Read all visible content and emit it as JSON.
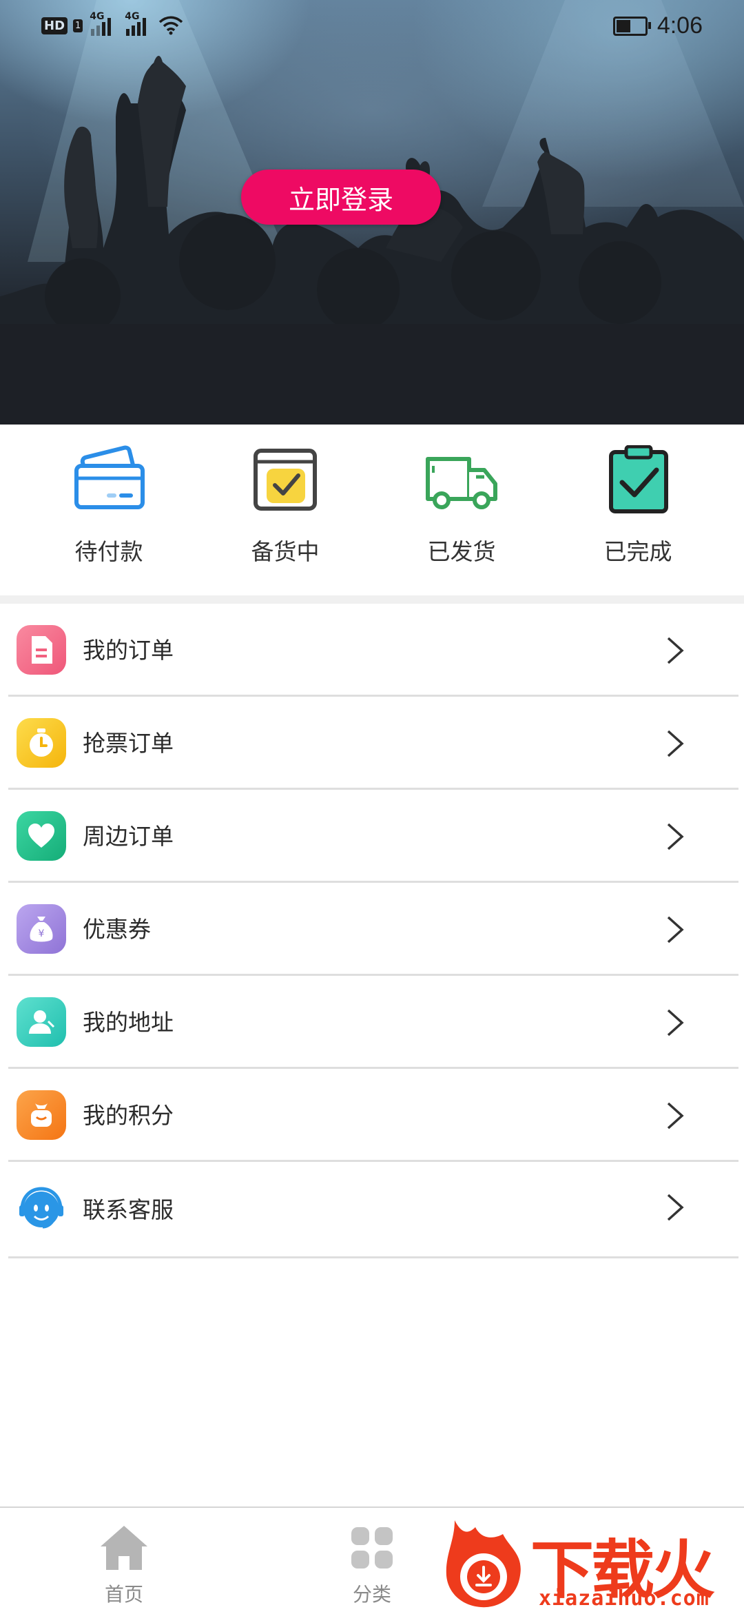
{
  "status_bar": {
    "hd": "HD",
    "sim": "1",
    "net1": "4G",
    "net2": "4G",
    "time": "4:06"
  },
  "hero": {
    "login_label": "立即登录"
  },
  "order_status": [
    {
      "label": "待付款",
      "icon": "card-icon",
      "color": "#2b8ee8"
    },
    {
      "label": "备货中",
      "icon": "calendar-check-icon",
      "color": "#f7d43f"
    },
    {
      "label": "已发货",
      "icon": "truck-icon",
      "color": "#3aa55a"
    },
    {
      "label": "已完成",
      "icon": "clipboard-check-icon",
      "color": "#3fcfb0"
    }
  ],
  "menu": [
    {
      "label": "我的订单",
      "icon": "document-icon",
      "color": "#f2607f"
    },
    {
      "label": "抢票订单",
      "icon": "stopwatch-icon",
      "color": "#f8c51b"
    },
    {
      "label": "周边订单",
      "icon": "heart-icon",
      "color": "#27c28d"
    },
    {
      "label": "优惠券",
      "icon": "money-bag-icon",
      "color": "#a98fe2"
    },
    {
      "label": "我的地址",
      "icon": "person-icon",
      "color": "#37cfc0"
    },
    {
      "label": "我的积分",
      "icon": "gift-bag-icon",
      "color": "#fa8a1c"
    },
    {
      "label": "联系客服",
      "icon": "headset-icon",
      "color": "#2a96e6"
    }
  ],
  "bottom_nav": [
    {
      "label": "首页",
      "icon": "home-icon"
    },
    {
      "label": "分类",
      "icon": "grid-icon"
    }
  ],
  "watermark": {
    "text": "下载火",
    "url": "xiazaihuo.com"
  }
}
